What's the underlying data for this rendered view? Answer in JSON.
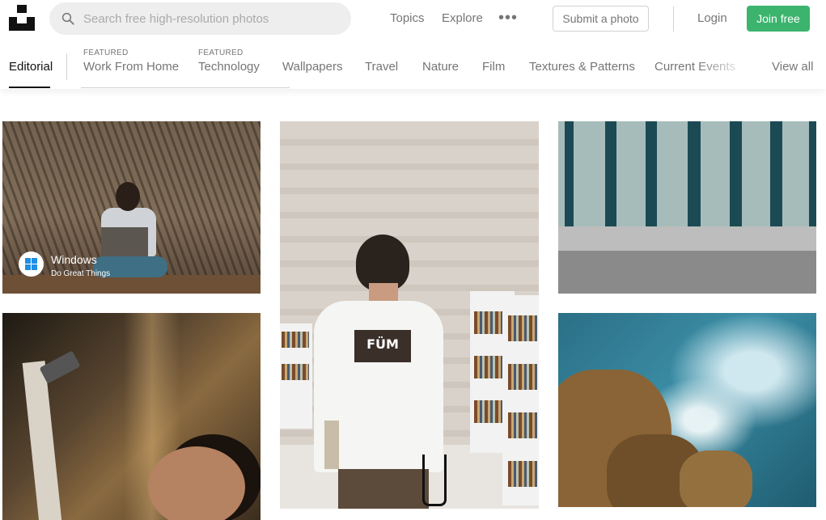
{
  "header": {
    "logo_name": "Unsplash",
    "search_placeholder": "Search free high-resolution photos",
    "nav": {
      "topics": "Topics",
      "explore": "Explore",
      "more": "•••"
    },
    "submit_label": "Submit a photo",
    "login_label": "Login",
    "join_label": "Join free"
  },
  "topics": {
    "editorial": "Editorial",
    "featured_label": "FEATURED",
    "featured": [
      "Work From Home",
      "Technology"
    ],
    "items": [
      "Wallpapers",
      "Travel",
      "Nature",
      "Film",
      "Textures & Patterns",
      "Current Events"
    ],
    "view_all": "View all"
  },
  "photos": {
    "sponsored": {
      "brand_name": "Windows",
      "tagline": "Do Great Things"
    },
    "shirt_print": "FÜM"
  },
  "colors": {
    "accent_green": "#3cb46e",
    "text_muted": "#767676",
    "search_bg": "#eeeeee"
  },
  "icons": [
    "logo-icon",
    "search-icon",
    "more-icon",
    "windows-icon"
  ]
}
